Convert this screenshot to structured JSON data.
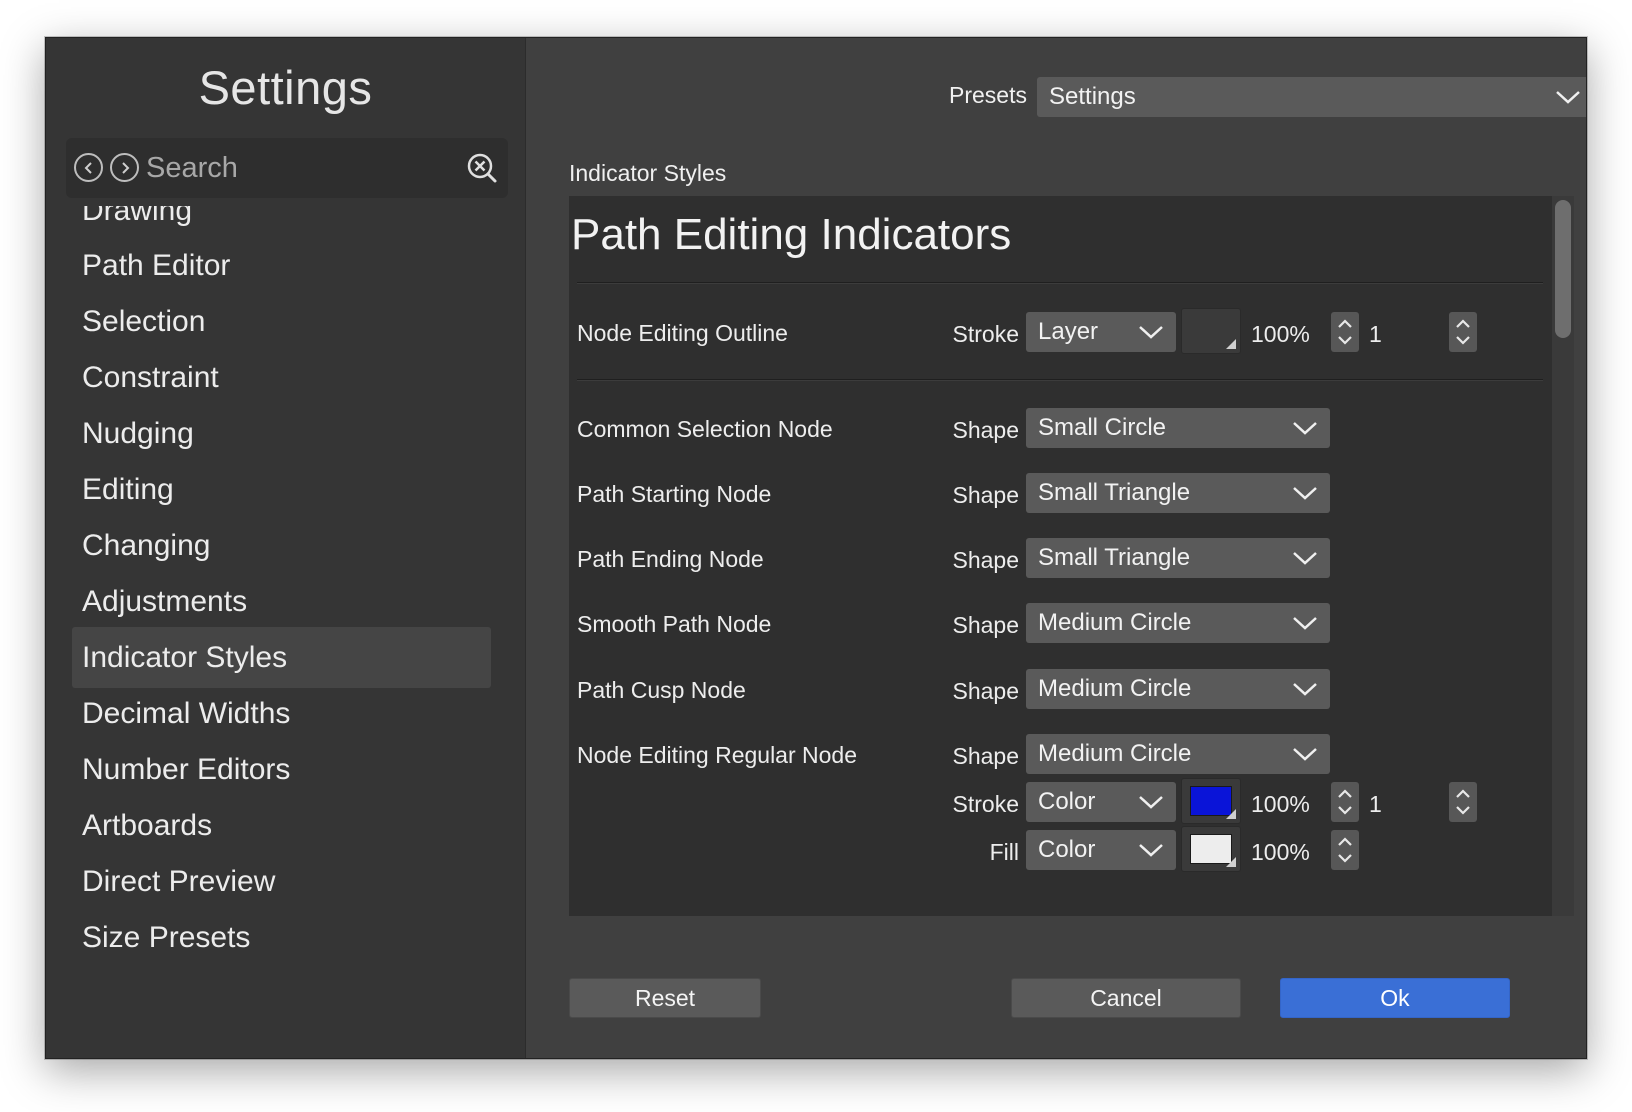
{
  "sidebar": {
    "title": "Settings",
    "search": {
      "placeholder": "Search"
    },
    "items": [
      {
        "label": "Drawing"
      },
      {
        "label": "Path Editor"
      },
      {
        "label": "Selection"
      },
      {
        "label": "Constraint"
      },
      {
        "label": "Nudging"
      },
      {
        "label": "Editing"
      },
      {
        "label": "Changing"
      },
      {
        "label": "Adjustments"
      },
      {
        "label": "Indicator Styles",
        "selected": true
      },
      {
        "label": "Decimal Widths"
      },
      {
        "label": "Number Editors"
      },
      {
        "label": "Artboards"
      },
      {
        "label": "Direct Preview"
      },
      {
        "label": "Size Presets"
      }
    ]
  },
  "presets": {
    "label": "Presets",
    "value": "Settings"
  },
  "section_label": "Indicator Styles",
  "panel": {
    "heading": "Path Editing Indicators",
    "outline": {
      "label": "Node Editing Outline",
      "stroke_label": "Stroke",
      "stroke_mode": "Layer",
      "swatch_color": "#3a3a3a",
      "opacity": "100%",
      "width": "1"
    },
    "nodes": [
      {
        "label": "Common Selection Node",
        "field": "Shape",
        "value": "Small Circle"
      },
      {
        "label": "Path Starting Node",
        "field": "Shape",
        "value": "Small Triangle"
      },
      {
        "label": "Path Ending Node",
        "field": "Shape",
        "value": "Small Triangle"
      },
      {
        "label": "Smooth Path Node",
        "field": "Shape",
        "value": "Medium Circle"
      },
      {
        "label": "Path Cusp Node",
        "field": "Shape",
        "value": "Medium Circle"
      },
      {
        "label": "Node Editing Regular Node",
        "field": "Shape",
        "value": "Medium Circle"
      }
    ],
    "regular_stroke": {
      "label": "Stroke",
      "mode": "Color",
      "swatch_color": "#0a14d8",
      "opacity": "100%",
      "width": "1"
    },
    "regular_fill": {
      "label": "Fill",
      "mode": "Color",
      "swatch_color": "#ededed",
      "opacity": "100%"
    }
  },
  "buttons": {
    "reset": "Reset",
    "cancel": "Cancel",
    "ok": "Ok"
  },
  "colors": {
    "accent": "#3a6fd6",
    "background": "#404040",
    "sidebar": "#353535"
  }
}
